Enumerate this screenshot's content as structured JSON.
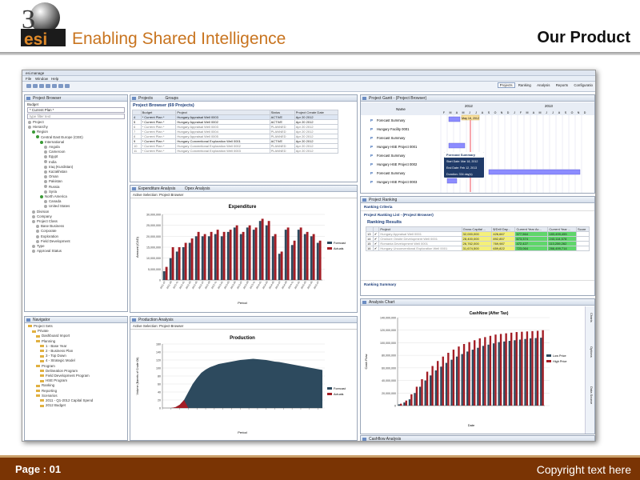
{
  "brand": {
    "logo_text": "3esi",
    "tagline": "Enabling Shared Intelligence",
    "heading": "Our Product"
  },
  "footer": {
    "page": "Page : 01",
    "copyright": "Copyright text here"
  },
  "app": {
    "title": "esi.manage",
    "menu": [
      "File",
      "Window",
      "Help"
    ],
    "perspectives": [
      "Projects",
      "Ranking",
      "Analysis",
      "Reports",
      "Configuratio"
    ],
    "project_browser": {
      "title": "Project Browser",
      "budget_label": "Budget",
      "budget_value": "* Current Plan *",
      "filter_placeholder": "type filter text",
      "tree": [
        "Project",
        "Hierarchy",
        "Region",
        "Central East Europe (CEE)",
        "International",
        "Angola",
        "Cameroon",
        "Egypt",
        "India",
        "Iraq (Kurdistan)",
        "Kazakhstan",
        "Oman",
        "Pakistan",
        "Russia",
        "Syria",
        "North America",
        "Canada",
        "United States",
        "Division",
        "Company",
        "Project Class",
        "Base Business",
        "Corporate",
        "Exploration",
        "Field Development",
        "Type",
        "Approval Status"
      ]
    },
    "navigator": {
      "title": "Navigator",
      "tree": [
        "Project Sets",
        "Private",
        "Dashboard Import",
        "Planning",
        "1 - Base Year",
        "2 - Business Plan",
        "3 - Top Down",
        "4 - Strategic Model",
        "Program",
        "Delineation Program",
        "Field Development Program",
        "HSE Program",
        "Ranking",
        "Reporting",
        "Scenarios",
        "2011 - Q1-2012 Capital Spend",
        "2012 Budget"
      ]
    },
    "projects": {
      "tabs": [
        "Projects",
        "Groups"
      ],
      "heading": "Project Browser (69 Projects)",
      "columns": [
        "",
        "Budget",
        "Project",
        "Status",
        "Project Create Date"
      ],
      "rows": [
        [
          "4",
          "* Current Plan *",
          "Hungary Appraisal Well 0003",
          "ACTIVE",
          "Apr 20 2012"
        ],
        [
          "5",
          "* Current Plan *",
          "Hungary Appraisal Well 0002",
          "ACTIVE",
          "Apr 20 2012"
        ],
        [
          "6",
          "* Current Plan *",
          "Hungary Appraisal Well 0003",
          "PLANNED",
          "Apr 20 2012"
        ],
        [
          "7",
          "* Current Plan *",
          "Hungary Appraisal Well 0004",
          "PLANNED",
          "Apr 20 2012"
        ],
        [
          "8",
          "* Current Plan *",
          "Hungary Appraisal Well 0005",
          "PLANNED",
          "Apr 20 2012"
        ],
        [
          "9",
          "* Current Plan *",
          "Hungary Conventional Exploration Well 0001",
          "ACTIVE",
          "Apr 20 2012"
        ],
        [
          "10",
          "* Current Plan *",
          "Hungary Conventional Exploration Well 0002",
          "PLANNED",
          "Apr 20 2012"
        ],
        [
          "11",
          "* Current Plan *",
          "Hungary Conventional Exploration Well 0003",
          "PLANNED",
          "Apr 20 2012"
        ]
      ]
    },
    "gantt": {
      "title": "Project Gantt - (Project Browser)",
      "name_col": "Name",
      "years": [
        "2012",
        "2013"
      ],
      "months": [
        "F",
        "M",
        "A",
        "M",
        "J",
        "J",
        "A",
        "S",
        "O",
        "N",
        "D",
        "J",
        "F",
        "M",
        "A",
        "M",
        "J",
        "J",
        "A",
        "S",
        "O",
        "N",
        "D"
      ],
      "rows": [
        "Forecast Summary",
        "Hungary Facility 0001",
        "Forecast Summary",
        "Hungary HSE Project 0001",
        "Forecast Summary",
        "Hungary HSE Project 0002",
        "Forecast Summary",
        "Hungary HSE Project 0003"
      ],
      "marker": "May 18, 2012",
      "tooltip": [
        "Forecast Summary",
        "Start Date: Mar 18, 2012",
        "End Date: Feb 12, 2013",
        "Duration: 334 day(s)"
      ]
    },
    "ranking": {
      "title": "Project Ranking",
      "criteria": "Ranking Criteria",
      "list": "Project Ranking List - (Project Browser)",
      "results": "Ranking Results",
      "summary": "Ranking Summary",
      "columns": [
        "",
        "",
        "Project",
        "Gross Capital ...",
        "$/Drill Day...",
        "Current Year Ac...",
        "Current Year ...",
        "Score"
      ],
      "rows": [
        [
          "13",
          "✔",
          "Hungary Appraisal Well 0001",
          "32,000,000",
          "426,667",
          "577,564",
          "183,499,455",
          ""
        ],
        [
          "14",
          "✔",
          "Onshore Onsite Development Well 0001",
          "28,400,000",
          "892,857",
          "673,374",
          "243,114,578",
          ""
        ],
        [
          "15",
          "✔",
          "Romania Development Well 0001",
          "26,762,000",
          "769,987",
          "472,427",
          "113,259,262",
          ""
        ],
        [
          "16",
          "✔",
          "Hungary Unconventional Exploration Well 0001",
          "31,674,500",
          "659,822",
          "723,064",
          "266,499,714",
          ""
        ]
      ]
    },
    "expenditure": {
      "tabs": [
        "Expenditure Analysis",
        "Opex Analysis"
      ],
      "active_selection": "Active Selection: Project Browser"
    },
    "production": {
      "tab": "Production Analysis",
      "active_selection": "Active Selection: Project Browser"
    },
    "analysis_chart": {
      "tab": "Analysis Chart",
      "side_tabs": [
        "Charts",
        "Options",
        "Data Source"
      ]
    },
    "cashflow": {
      "tab": "Cashflow Analysis"
    }
  },
  "chart_data": [
    {
      "type": "bar",
      "title": "Expenditure",
      "xlabel": "Period",
      "ylabel": "Amount (CAD)",
      "yticks": [
        "0",
        "5,000,000",
        "10,000,000",
        "15,000,000",
        "20,000,000",
        "25,000,000",
        "30,000,000"
      ],
      "ylim": [
        0,
        30000000
      ],
      "categories": [
        "2011-07",
        "2011-09",
        "2011-11",
        "2012-01",
        "2012-03",
        "2012-05",
        "2012-07",
        "2012-09",
        "2012-11",
        "2013-01",
        "2013-03",
        "2013-05",
        "2013-07",
        "2013-09",
        "2013-11",
        "2014-01",
        "2014-03",
        "2014-05",
        "2014-07",
        "2014-09",
        "2014-11",
        "2015-01",
        "2015-03",
        "2015-05",
        "2015-07"
      ],
      "series": [
        {
          "name": "Forecast",
          "color": "#2d4a5e",
          "values": [
            4000000,
            10000000,
            13000000,
            15000000,
            17000000,
            20000000,
            20000000,
            20000000,
            21000000,
            20000000,
            22000000,
            24000000,
            21000000,
            24000000,
            23000000,
            27000000,
            25000000,
            20000000,
            12000000,
            23000000,
            16000000,
            23000000,
            21000000,
            20000000,
            17000000
          ]
        },
        {
          "name": "Actuals",
          "color": "#a31d25",
          "values": [
            6000000,
            15000000,
            15000000,
            17000000,
            19000000,
            22000000,
            21000000,
            22000000,
            23000000,
            22000000,
            23000000,
            25000000,
            22000000,
            25000000,
            24000000,
            28000000,
            27000000,
            21000000,
            13000000,
            24000000,
            18000000,
            24000000,
            22000000,
            21000000,
            18000000
          ]
        }
      ]
    },
    {
      "type": "area",
      "title": "Production",
      "xlabel": "Period",
      "ylabel": "Volume (Barrels of Crude Oil)",
      "yticks": [
        "0",
        "20",
        "40",
        "60",
        "80",
        "100",
        "120",
        "140",
        "160"
      ],
      "ylim": [
        0,
        160
      ],
      "series": [
        {
          "name": "Forecast",
          "color": "#2d4a5e",
          "values": [
            0,
            0,
            0,
            2,
            8,
            20,
            40,
            60,
            75,
            88,
            96,
            102,
            106,
            110,
            112,
            114,
            116,
            118,
            120,
            121,
            122,
            123,
            122,
            121,
            120,
            118,
            116,
            115,
            113,
            111,
            109,
            107,
            105,
            103,
            101,
            99,
            97,
            95
          ]
        },
        {
          "name": "Actuals",
          "color": "#a31d25",
          "values": [
            0,
            0,
            0,
            2,
            8,
            20,
            0,
            0,
            0,
            0,
            0,
            0,
            0,
            0,
            0,
            0,
            0,
            0,
            0,
            0,
            0,
            0,
            0,
            0,
            0,
            0,
            0,
            0,
            0,
            0,
            0,
            0,
            0,
            0,
            0,
            0,
            0,
            0
          ]
        }
      ]
    },
    {
      "type": "bar",
      "title": "CashNow (After Tax)",
      "xlabel": "Date",
      "ylabel": "Cash Flow",
      "yticks": [
        "0",
        "20,000,000",
        "40,000,000",
        "60,000,000",
        "80,000,000",
        "100,000,000",
        "120,000,000",
        "140,000,000"
      ],
      "ylim": [
        0,
        140000000
      ],
      "series": [
        {
          "name": "Low Price",
          "color": "#2d4a5e",
          "values": [
            2000000,
            5000000,
            10000000,
            20000000,
            30000000,
            40000000,
            48000000,
            56000000,
            62000000,
            68000000,
            73000000,
            78000000,
            82000000,
            86000000,
            89000000,
            92000000,
            95000000,
            97000000,
            99000000,
            101000000,
            102000000,
            103000000,
            104000000,
            105000000,
            106000000,
            107000000,
            107500000,
            108000000
          ]
        },
        {
          "name": "High Price",
          "color": "#a31d25",
          "values": [
            3000000,
            8000000,
            18000000,
            30000000,
            42000000,
            54000000,
            63000000,
            71000000,
            78000000,
            84000000,
            89000000,
            94000000,
            98000000,
            101000000,
            104000000,
            107000000,
            109000000,
            111000000,
            113000000,
            114000000,
            115000000,
            116000000,
            117000000,
            117500000,
            118000000,
            118500000,
            119000000,
            120000000
          ]
        }
      ]
    }
  ]
}
